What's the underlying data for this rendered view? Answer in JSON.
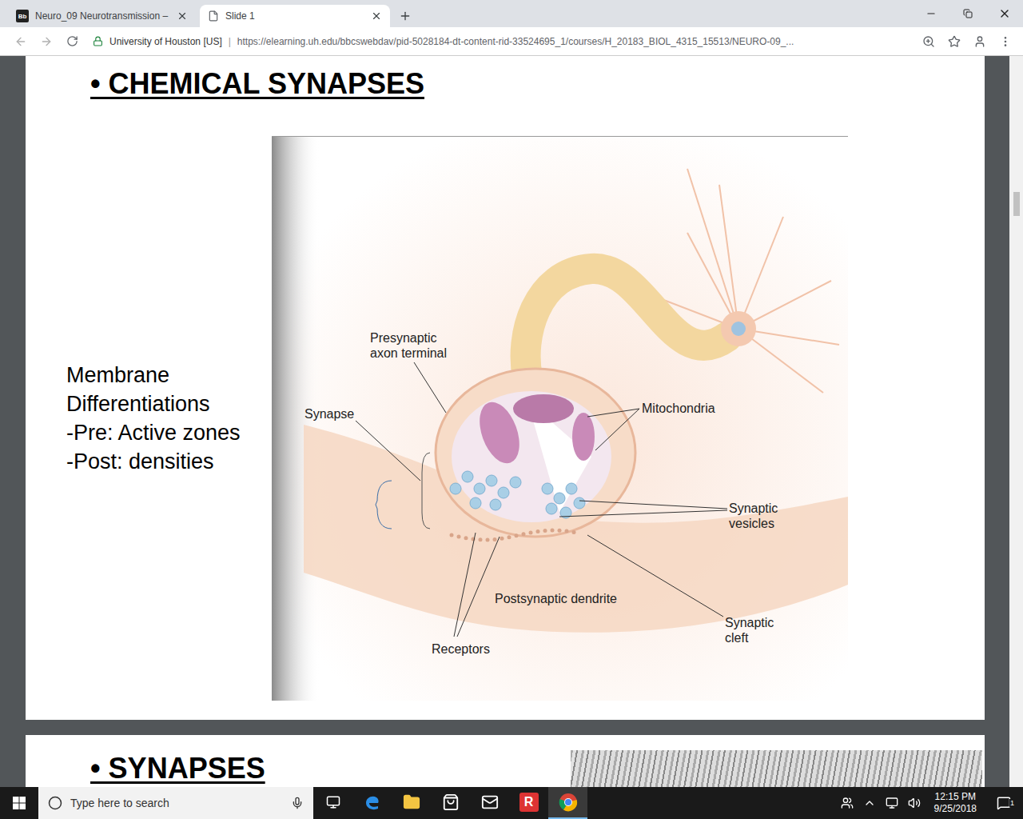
{
  "window": {
    "tabs": [
      {
        "label": "Neuro_09 Neurotransmission –",
        "favicon": "Bb",
        "kind": "blackboard",
        "selected": false
      },
      {
        "label": "Slide 1",
        "favicon": "",
        "kind": "document",
        "selected": true
      }
    ],
    "address": {
      "site": "University of Houston [US]",
      "separator": "|",
      "url": "https://elearning.uh.edu/bbcswebdav/pid-5028184-dt-content-rid-33524695_1/courses/H_20183_BIOL_4315_15513/NEURO-09_..."
    }
  },
  "slides": [
    {
      "title": "• CHEMICAL SYNAPSES",
      "notes": [
        "Membrane",
        "Differentiations",
        "-Pre: Active zones",
        "-Post: densities"
      ],
      "diagram": {
        "labels": [
          {
            "lines": [
              "Presynaptic",
              "axon terminal"
            ]
          },
          {
            "lines": [
              "Synapse"
            ]
          },
          {
            "lines": [
              "Mitochondria"
            ]
          },
          {
            "lines": [
              "Synaptic",
              "vesicles"
            ]
          },
          {
            "lines": [
              "Postsynaptic dendrite"
            ]
          },
          {
            "lines": [
              "Synaptic",
              "cleft"
            ]
          },
          {
            "lines": [
              "Receptors"
            ]
          }
        ]
      }
    },
    {
      "title": "• SYNAPSES"
    }
  ],
  "taskbar": {
    "search": {
      "placeholder": "Type here to search"
    },
    "apps": [
      {
        "kind": "taskview",
        "label": "",
        "active": false
      },
      {
        "kind": "edge",
        "label": "",
        "active": false
      },
      {
        "kind": "explorer",
        "label": "",
        "active": false
      },
      {
        "kind": "store",
        "label": "",
        "active": false
      },
      {
        "kind": "mail",
        "label": "",
        "active": false
      },
      {
        "kind": "r",
        "label": "R",
        "active": false
      },
      {
        "kind": "chrome",
        "label": "",
        "active": true
      }
    ],
    "time": "12:15 PM",
    "date": "9/25/2018",
    "notifications": "1"
  }
}
